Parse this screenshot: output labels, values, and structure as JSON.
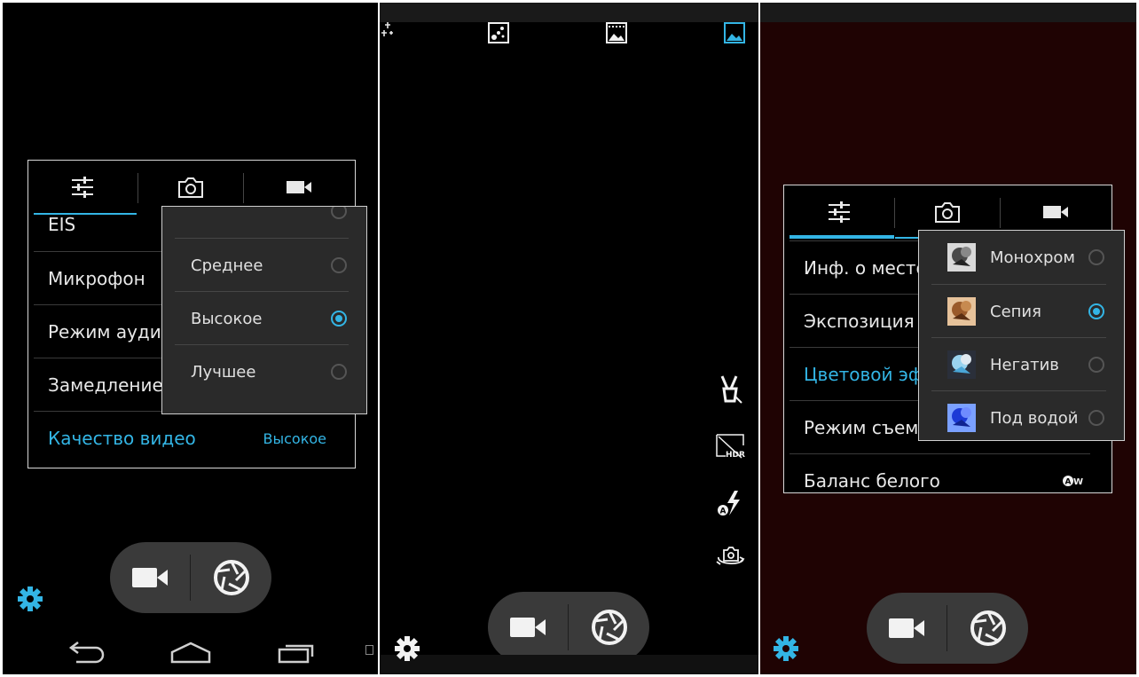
{
  "screen1": {
    "settings_tabs": [
      "general-settings",
      "photo-settings",
      "video-settings"
    ],
    "settings_rows": [
      {
        "label": "EIS"
      },
      {
        "label": "Микрофон"
      },
      {
        "label": "Режим аудио"
      },
      {
        "label": "Замедление"
      },
      {
        "label": "Качество видео",
        "value": "Высокое",
        "active": true
      }
    ],
    "quality_popup": {
      "options": [
        {
          "label": "Среднее",
          "selected": false
        },
        {
          "label": "Высокое",
          "selected": true
        },
        {
          "label": "Лучшее",
          "selected": false
        }
      ]
    },
    "nav_buttons": [
      "back-icon",
      "home-icon",
      "recent-apps-icon"
    ]
  },
  "screen2": {
    "mode_icons": [
      "sparkle-icon",
      "dots-filter-icon",
      "panorama-icon",
      "gallery-icon"
    ],
    "side_icons": [
      "gesture-shot-icon",
      "hdr-icon",
      "auto-flash-icon",
      "switch-camera-icon"
    ]
  },
  "screen3": {
    "settings_rows": [
      {
        "label": "Инф. о местоположении"
      },
      {
        "label": "Экспозиция"
      },
      {
        "label": "Цветовой эффект",
        "active": true
      },
      {
        "label": "Режим съемки"
      },
      {
        "label": "Баланс белого",
        "value_icon": "auto-white-balance-icon"
      }
    ],
    "effect_popup": {
      "options": [
        {
          "label": "Монохром",
          "selected": false
        },
        {
          "label": "Сепия",
          "selected": true
        },
        {
          "label": "Негатив",
          "selected": false
        },
        {
          "label": "Под водой",
          "selected": false
        }
      ]
    }
  },
  "colors": {
    "accent": "#33b5e5",
    "panel_border": "#d8d8d8",
    "popup_bg": "#2a2a2a",
    "screen3_bg": "#1f0303"
  }
}
